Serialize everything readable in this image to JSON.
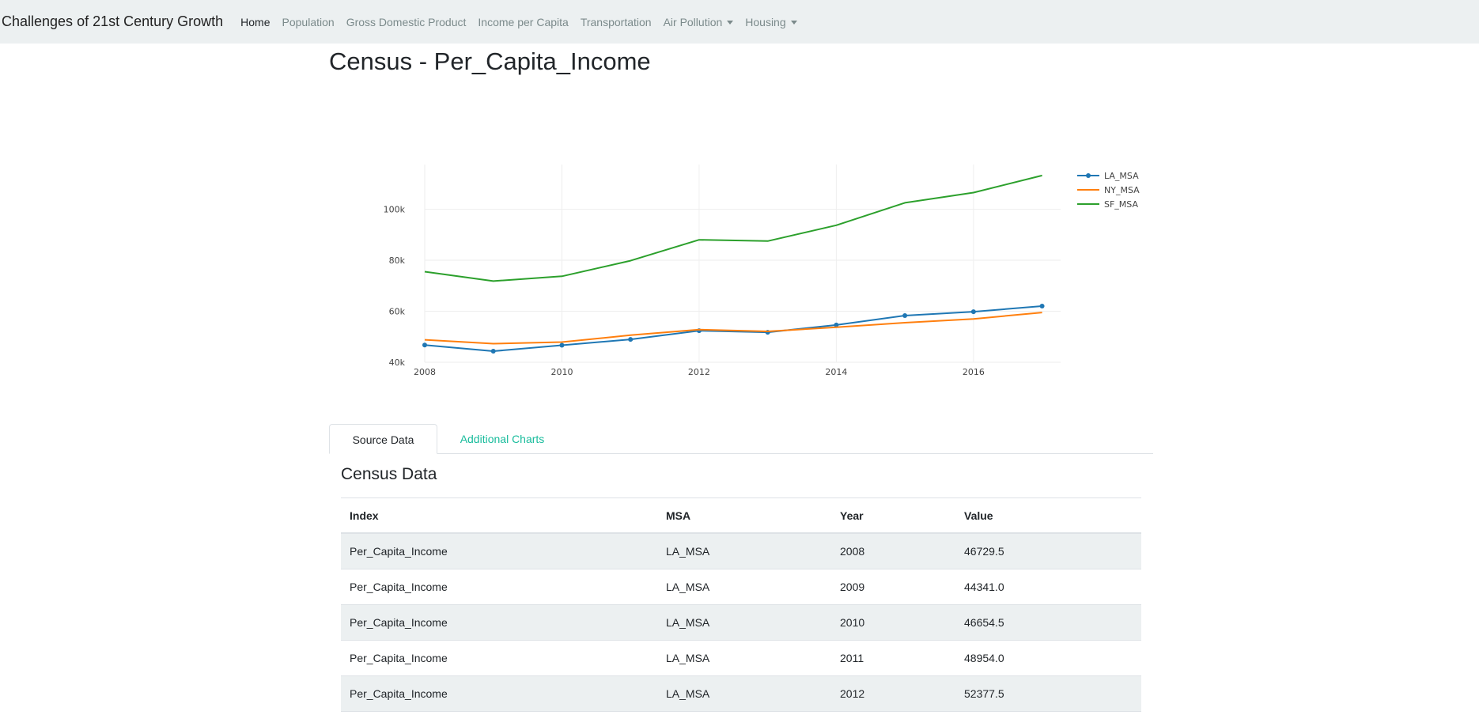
{
  "navbar": {
    "brand": "Challenges of 21st Century Growth",
    "items": [
      {
        "label": "Home",
        "active": true,
        "dropdown": false
      },
      {
        "label": "Population",
        "active": false,
        "dropdown": false
      },
      {
        "label": "Gross Domestic Product",
        "active": false,
        "dropdown": false
      },
      {
        "label": "Income per Capita",
        "active": false,
        "dropdown": false
      },
      {
        "label": "Transportation",
        "active": false,
        "dropdown": false
      },
      {
        "label": "Air Pollution",
        "active": false,
        "dropdown": true
      },
      {
        "label": "Housing",
        "active": false,
        "dropdown": true
      }
    ]
  },
  "page": {
    "title": "Census - Per_Capita_Income"
  },
  "chart_data": {
    "type": "line",
    "x": [
      2008,
      2009,
      2010,
      2011,
      2012,
      2013,
      2014,
      2015,
      2016,
      2017
    ],
    "series": [
      {
        "name": "LA_MSA",
        "color": "#1f77b4",
        "markers": true,
        "values": [
          46729.5,
          44341.0,
          46654.5,
          48954.0,
          52377.5,
          51750,
          54600,
          58300,
          59800,
          62000
        ]
      },
      {
        "name": "NY_MSA",
        "color": "#ff7f0e",
        "markers": false,
        "values": [
          48800,
          47300,
          47900,
          50600,
          52800,
          52100,
          53700,
          55500,
          57000,
          59500
        ]
      },
      {
        "name": "SF_MSA",
        "color": "#2ca02c",
        "markers": false,
        "values": [
          75500,
          71800,
          73700,
          79800,
          88000,
          87500,
          93700,
          102500,
          106500,
          113200
        ]
      }
    ],
    "x_ticks": [
      2008,
      2010,
      2012,
      2014,
      2016
    ],
    "y_ticks": [
      40000,
      60000,
      80000,
      100000
    ],
    "y_tick_labels": [
      "40k",
      "60k",
      "80k",
      "100k"
    ],
    "xlim": [
      2008,
      2017.27
    ],
    "ylim": [
      40000,
      117500
    ],
    "grid": true,
    "legend_position": "top-right"
  },
  "tabs": [
    {
      "label": "Source Data",
      "active": true
    },
    {
      "label": "Additional Charts",
      "active": false
    }
  ],
  "table": {
    "title": "Census Data",
    "headers": [
      "Index",
      "MSA",
      "Year",
      "Value"
    ],
    "rows": [
      [
        "Per_Capita_Income",
        "LA_MSA",
        "2008",
        "46729.5"
      ],
      [
        "Per_Capita_Income",
        "LA_MSA",
        "2009",
        "44341.0"
      ],
      [
        "Per_Capita_Income",
        "LA_MSA",
        "2010",
        "46654.5"
      ],
      [
        "Per_Capita_Income",
        "LA_MSA",
        "2011",
        "48954.0"
      ],
      [
        "Per_Capita_Income",
        "LA_MSA",
        "2012",
        "52377.5"
      ]
    ]
  }
}
